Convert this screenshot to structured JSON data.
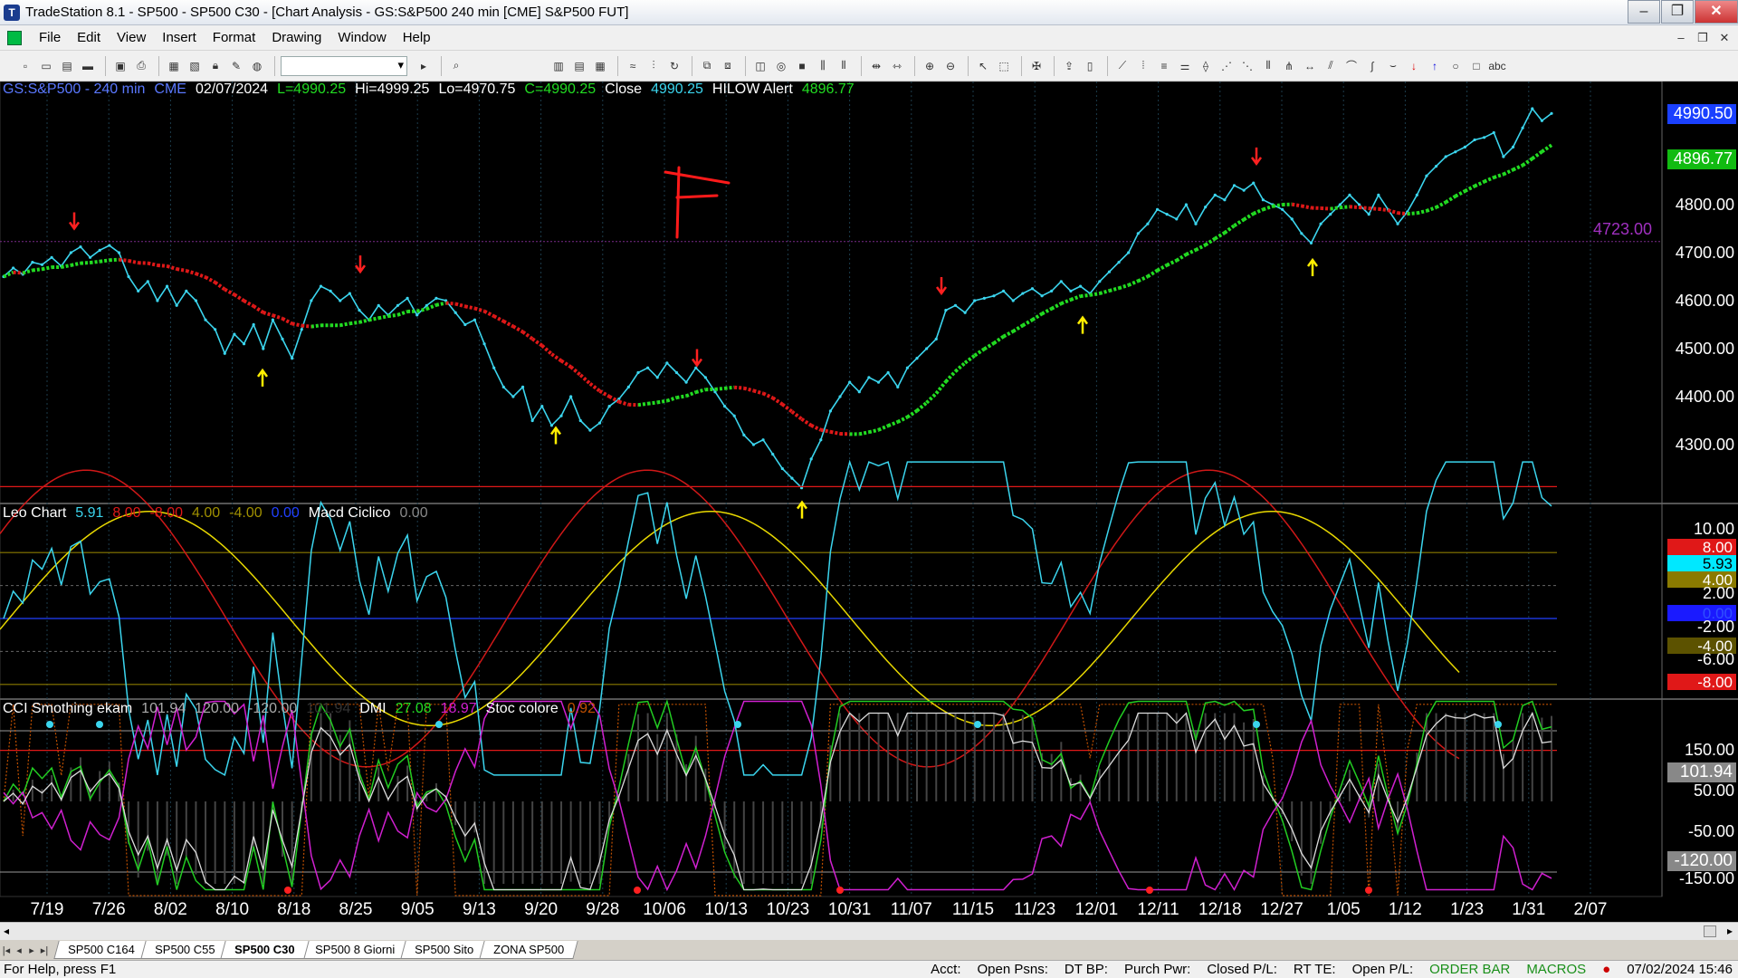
{
  "window": {
    "title": "TradeStation 8.1 - SP500 - SP500 C30 - [Chart Analysis - GS:S&P500  240 min  [CME] S&P500 FUT]",
    "minimize": "‒",
    "maximize": "❐",
    "close": "✕"
  },
  "menu": {
    "items": [
      "File",
      "Edit",
      "View",
      "Insert",
      "Format",
      "Drawing",
      "Window",
      "Help"
    ],
    "mdi": [
      "‒",
      "❐",
      "✕"
    ]
  },
  "chart_header": {
    "symbol": "GS:S&P500 - 240 min",
    "exchange": "CME",
    "date": "02/07/2024",
    "last": "L=4990.25",
    "high": "Hi=4999.25",
    "low": "Lo=4970.75",
    "close_val": "C=4990.25",
    "close_label": "Close",
    "close_price": "4990.25",
    "alert_label": "HILOW Alert",
    "alert_value": "4896.77"
  },
  "price_panel": {
    "ticks": [
      "4800.00",
      "4700.00",
      "4600.00",
      "4500.00",
      "4400.00",
      "4300.00"
    ],
    "current_price": "4990.50",
    "alert_price": "4896.77",
    "level_label": "4723.00",
    "annotation": "F"
  },
  "osc_panel": {
    "name": "Leo Chart",
    "v1": "5.91",
    "v2": "8.00",
    "v3": "-8.00",
    "v4": "4.00",
    "v5": "-4.00",
    "v6": "0.00",
    "name2": "Macd Ciclico",
    "v7": "0.00",
    "ticks": [
      "10.00",
      "8.00",
      "5.93",
      "4.00",
      "2.00",
      "0.00",
      "-2.00",
      "-4.00",
      "-6.00",
      "-8.00"
    ]
  },
  "cci_panel": {
    "name": "CCI Smothing ekam",
    "v1": "101.94",
    "v2": "120.00",
    "v3": "-120.00",
    "v4": "101.94",
    "name2": "DMI",
    "v5": "27.08",
    "v6": "18.97",
    "name3": "Stoc colore",
    "v7": "0.92",
    "ticks": [
      "150.00",
      "101.94",
      "50.00",
      "-50.00",
      "-120.00",
      "-150.00"
    ]
  },
  "date_axis": [
    "7/19",
    "7/26",
    "8/02",
    "8/10",
    "8/18",
    "8/25",
    "9/05",
    "9/13",
    "9/20",
    "9/28",
    "10/06",
    "10/13",
    "10/23",
    "10/31",
    "11/07",
    "11/15",
    "11/23",
    "12/01",
    "12/11",
    "12/18",
    "12/27",
    "1/05",
    "1/12",
    "1/23",
    "1/31",
    "2/07"
  ],
  "tabs": {
    "nav": [
      "|◂",
      "◂",
      "▸",
      "▸|"
    ],
    "items": [
      "SP500 C164",
      "SP500 C55",
      "SP500 C30",
      "SP500 8 Giorni",
      "SP500 Sito",
      "ZONA SP500"
    ],
    "active": "SP500 C30"
  },
  "status": {
    "help": "For Help, press F1",
    "acct": "Acct:",
    "open_psns": "Open Psns:",
    "dt_bp": "DT BP:",
    "purch_pwr": "Purch Pwr:",
    "closed_pl": "Closed P/L:",
    "rt_te": "RT TE:",
    "open_pl": "Open P/L:",
    "order_bar": "ORDER BAR",
    "macros": "MACROS",
    "datetime": "07/02/2024 15:46"
  },
  "colors": {
    "price_line": "#3bd5ee",
    "ma_up": "#22dd22",
    "ma_down": "#e01818",
    "yellow": "#ffee00",
    "magenta": "#d020d0"
  },
  "price_series": [
    4650,
    4668,
    4655,
    4680,
    4675,
    4690,
    4672,
    4700,
    4712,
    4690,
    4705,
    4715,
    4700,
    4650,
    4620,
    4640,
    4600,
    4630,
    4590,
    4620,
    4600,
    4560,
    4540,
    4490,
    4530,
    4510,
    4550,
    4500,
    4560,
    4520,
    4480,
    4540,
    4600,
    4630,
    4620,
    4600,
    4615,
    4580,
    4560,
    4590,
    4570,
    4590,
    4605,
    4570,
    4590,
    4605,
    4600,
    4575,
    4550,
    4560,
    4510,
    4460,
    4420,
    4400,
    4420,
    4350,
    4380,
    4340,
    4360,
    4400,
    4350,
    4330,
    4345,
    4380,
    4395,
    4420,
    4450,
    4460,
    4440,
    4470,
    4450,
    4430,
    4460,
    4440,
    4410,
    4380,
    4360,
    4320,
    4300,
    4310,
    4280,
    4250,
    4230,
    4210,
    4270,
    4310,
    4370,
    4400,
    4430,
    4410,
    4440,
    4430,
    4450,
    4420,
    4460,
    4480,
    4500,
    4520,
    4580,
    4590,
    4575,
    4600,
    4605,
    4610,
    4620,
    4600,
    4615,
    4625,
    4610,
    4620,
    4640,
    4620,
    4630,
    4615,
    4640,
    4660,
    4680,
    4700,
    4740,
    4760,
    4790,
    4780,
    4770,
    4800,
    4760,
    4795,
    4820,
    4810,
    4840,
    4830,
    4845,
    4810,
    4800,
    4790,
    4770,
    4740,
    4720,
    4760,
    4780,
    4800,
    4820,
    4800,
    4780,
    4820,
    4790,
    4760,
    4785,
    4820,
    4860,
    4880,
    4900,
    4910,
    4920,
    4935,
    4940,
    4950,
    4900,
    4920,
    4960,
    5000,
    4975,
    4990
  ]
}
